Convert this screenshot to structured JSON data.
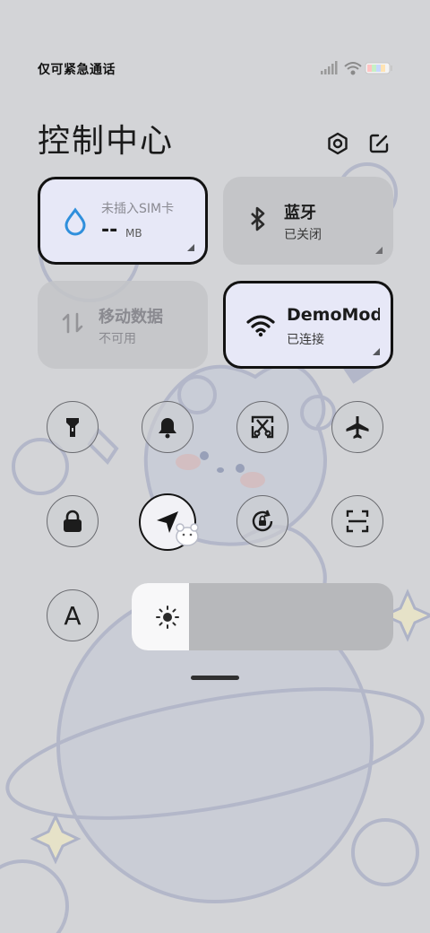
{
  "status_bar": {
    "carrier_text": "仅可紧急通话"
  },
  "header": {
    "title": "控制中心"
  },
  "tiles": {
    "sim": {
      "label": "未插入SIM卡",
      "value": "--",
      "unit": "MB"
    },
    "bluetooth": {
      "label": "蓝牙",
      "status": "已关闭"
    },
    "mobile_data": {
      "label": "移动数据",
      "status": "不可用"
    },
    "wifi": {
      "label": "DemoMod",
      "status": "已连接"
    }
  },
  "toggles": [
    {
      "name": "flashlight-icon",
      "on": false
    },
    {
      "name": "bell-icon",
      "on": false
    },
    {
      "name": "screenshot-icon",
      "on": false
    },
    {
      "name": "airplane-icon",
      "on": false
    },
    {
      "name": "lock-icon",
      "on": false
    },
    {
      "name": "location-icon",
      "on": true
    },
    {
      "name": "rotation-lock-icon",
      "on": false
    },
    {
      "name": "scan-icon",
      "on": false
    }
  ],
  "text_size_glyph": "A",
  "brightness": {
    "level": 0.22
  },
  "colors": {
    "accent_active_bg": "#e7e8f7",
    "water_drop": "#2f8fdc",
    "background": "#d3d4d7"
  }
}
